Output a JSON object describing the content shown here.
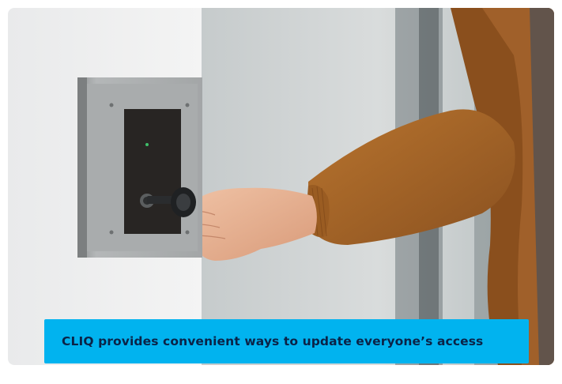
{
  "caption": {
    "text": "CLIQ provides convenient ways to update everyone’s access"
  },
  "colors": {
    "caption_background": "#01b3ef",
    "caption_text": "#0b2347"
  },
  "icons": {
    "photo": "hand-inserting-key-photo"
  }
}
